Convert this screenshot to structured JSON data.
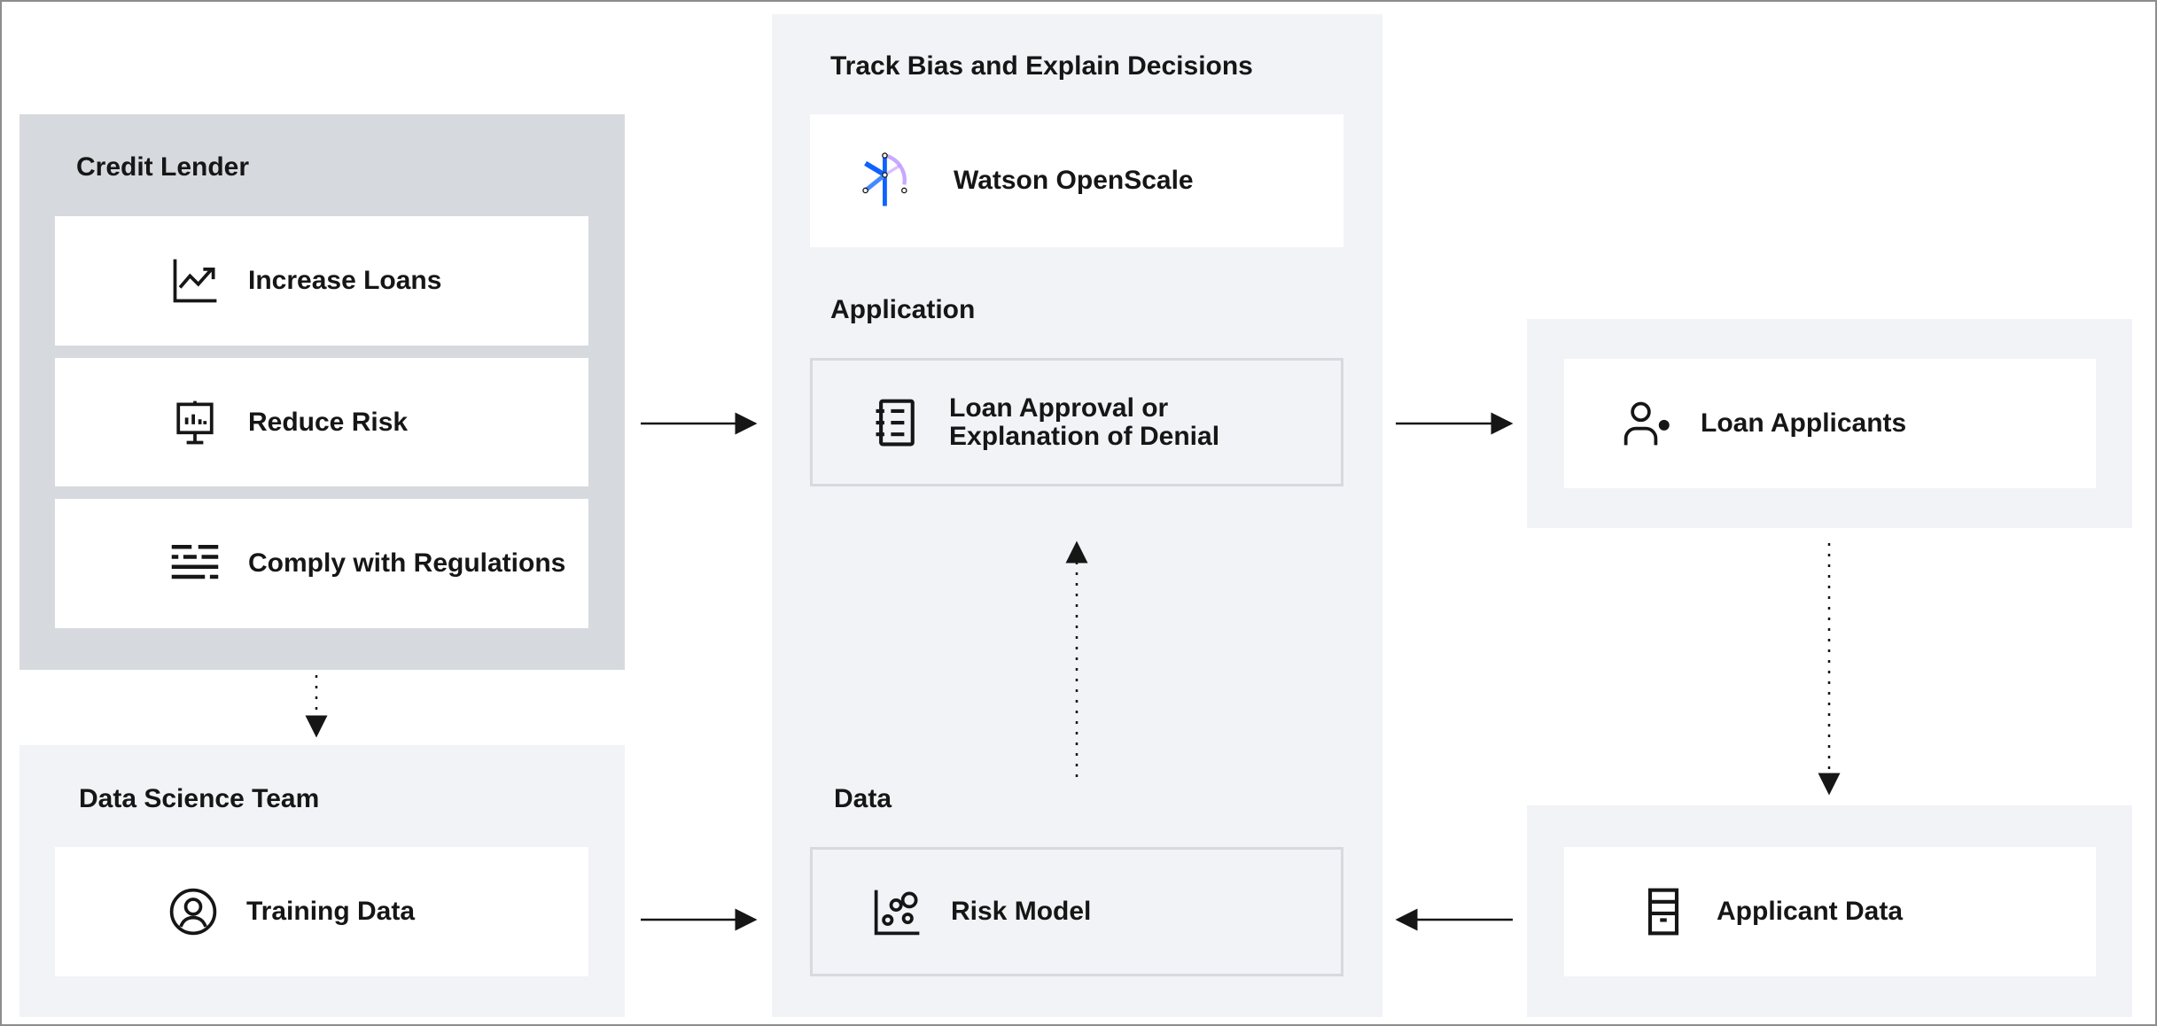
{
  "credit_lender": {
    "title": "Credit Lender",
    "items": [
      {
        "label": "Increase Loans",
        "icon": "chart-line-up-icon"
      },
      {
        "label": "Reduce Risk",
        "icon": "presentation-chart-icon"
      },
      {
        "label": "Comply with Regulations",
        "icon": "text-lines-icon"
      }
    ]
  },
  "data_science": {
    "title": "Data Science Team",
    "item": {
      "label": "Training Data",
      "icon": "user-avatar-icon"
    }
  },
  "center": {
    "title": "Track Bias and Explain Decisions",
    "watson": {
      "label": "Watson OpenScale",
      "icon": "watson-openscale-logo"
    },
    "application_title": "Application",
    "application": {
      "label_line1": "Loan Approval or",
      "label_line2": "Explanation of Denial",
      "icon": "notebook-icon"
    },
    "data_title": "Data",
    "data": {
      "label": "Risk Model",
      "icon": "scatter-model-icon"
    }
  },
  "right": {
    "applicants": {
      "label": "Loan Applicants",
      "icon": "user-online-icon"
    },
    "applicant_data": {
      "label": "Applicant Data",
      "icon": "data-cabinet-icon"
    }
  },
  "colors": {
    "dark_panel": "#d6d9de",
    "light_panel": "#f2f3f7",
    "accent_blue": "#0f62fe",
    "accent_purple": "#a56eff"
  }
}
